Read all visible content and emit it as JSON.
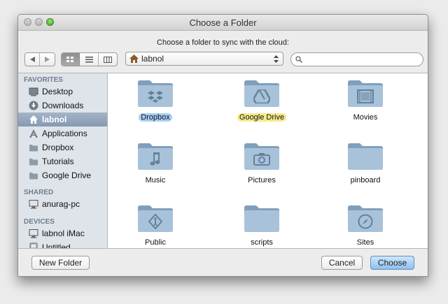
{
  "window": {
    "title": "Choose a Folder",
    "prompt": "Choose a folder to sync with the cloud:"
  },
  "toolbar": {
    "back_icon": "back-arrow-icon",
    "forward_icon": "forward-arrow-icon",
    "views": [
      "icon-view",
      "list-view",
      "column-view"
    ],
    "path": "labnol",
    "search_placeholder": ""
  },
  "sidebar": {
    "favorites_label": "FAVORITES",
    "favorites": [
      {
        "label": "Desktop",
        "icon": "desktop-icon"
      },
      {
        "label": "Downloads",
        "icon": "downloads-icon"
      },
      {
        "label": "labnol",
        "icon": "home-icon",
        "selected": true
      },
      {
        "label": "Applications",
        "icon": "applications-icon"
      },
      {
        "label": "Dropbox",
        "icon": "folder-icon"
      },
      {
        "label": "Tutorials",
        "icon": "folder-icon"
      },
      {
        "label": "Google Drive",
        "icon": "folder-icon"
      }
    ],
    "shared_label": "SHARED",
    "shared": [
      {
        "label": "anurag-pc",
        "icon": "pc-icon"
      }
    ],
    "devices_label": "DEVICES",
    "devices": [
      {
        "label": "labnol iMac",
        "icon": "imac-icon"
      },
      {
        "label": "Untitled",
        "icon": "disk-icon"
      }
    ]
  },
  "folders": [
    {
      "name": "Dropbox",
      "icon": "dropbox-icon",
      "label_color": "#a9cdf4"
    },
    {
      "name": "Google Drive",
      "icon": "google-drive-icon",
      "label_color": "#f6ea8a"
    },
    {
      "name": "Movies",
      "icon": "film-icon"
    },
    {
      "name": "Music",
      "icon": "music-note-icon"
    },
    {
      "name": "Pictures",
      "icon": "camera-icon"
    },
    {
      "name": "pinboard",
      "icon": "folder-icon"
    },
    {
      "name": "Public",
      "icon": "public-icon"
    },
    {
      "name": "scripts",
      "icon": "folder-icon"
    },
    {
      "name": "Sites",
      "icon": "compass-icon"
    }
  ],
  "buttons": {
    "new_folder": "New Folder",
    "cancel": "Cancel",
    "choose": "Choose"
  },
  "colors": {
    "sidebar_bg": "#dee4ea",
    "selection": "#8a9db5",
    "default_button": "#9fc9f2",
    "folder": "#9fbbd6"
  }
}
